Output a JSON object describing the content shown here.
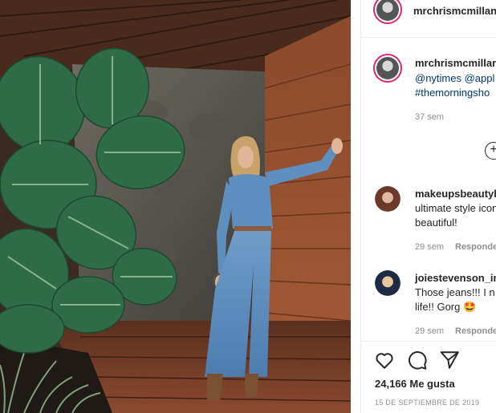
{
  "post": {
    "author": "mrchrismcmillan",
    "caption_line1": "@nytimes @appl",
    "caption_line2": "#themorningsho",
    "caption_time": "37 sem",
    "likes": "24,166 Me gusta",
    "date": "15 DE SEPTIEMBRE DE 2019"
  },
  "comments": [
    {
      "user": "makeupsbeautybr",
      "line1": "ultimate style icon",
      "line2": "beautiful!",
      "time": "29 sem",
      "reply": "Responder"
    },
    {
      "user": "joiestevenson_ir",
      "line1": "Those jeans!!! I n",
      "line2": "life!! Gorg 🤩",
      "time": "29 sem",
      "reply": "Responder"
    }
  ],
  "icons": {
    "like": "heart-icon",
    "comment": "comment-icon",
    "share": "share-icon",
    "more_comments": "plus-circle-icon"
  },
  "colors": {
    "link": "#00376b",
    "muted": "#8e8e8e",
    "avatar_ring": "#d62976"
  }
}
